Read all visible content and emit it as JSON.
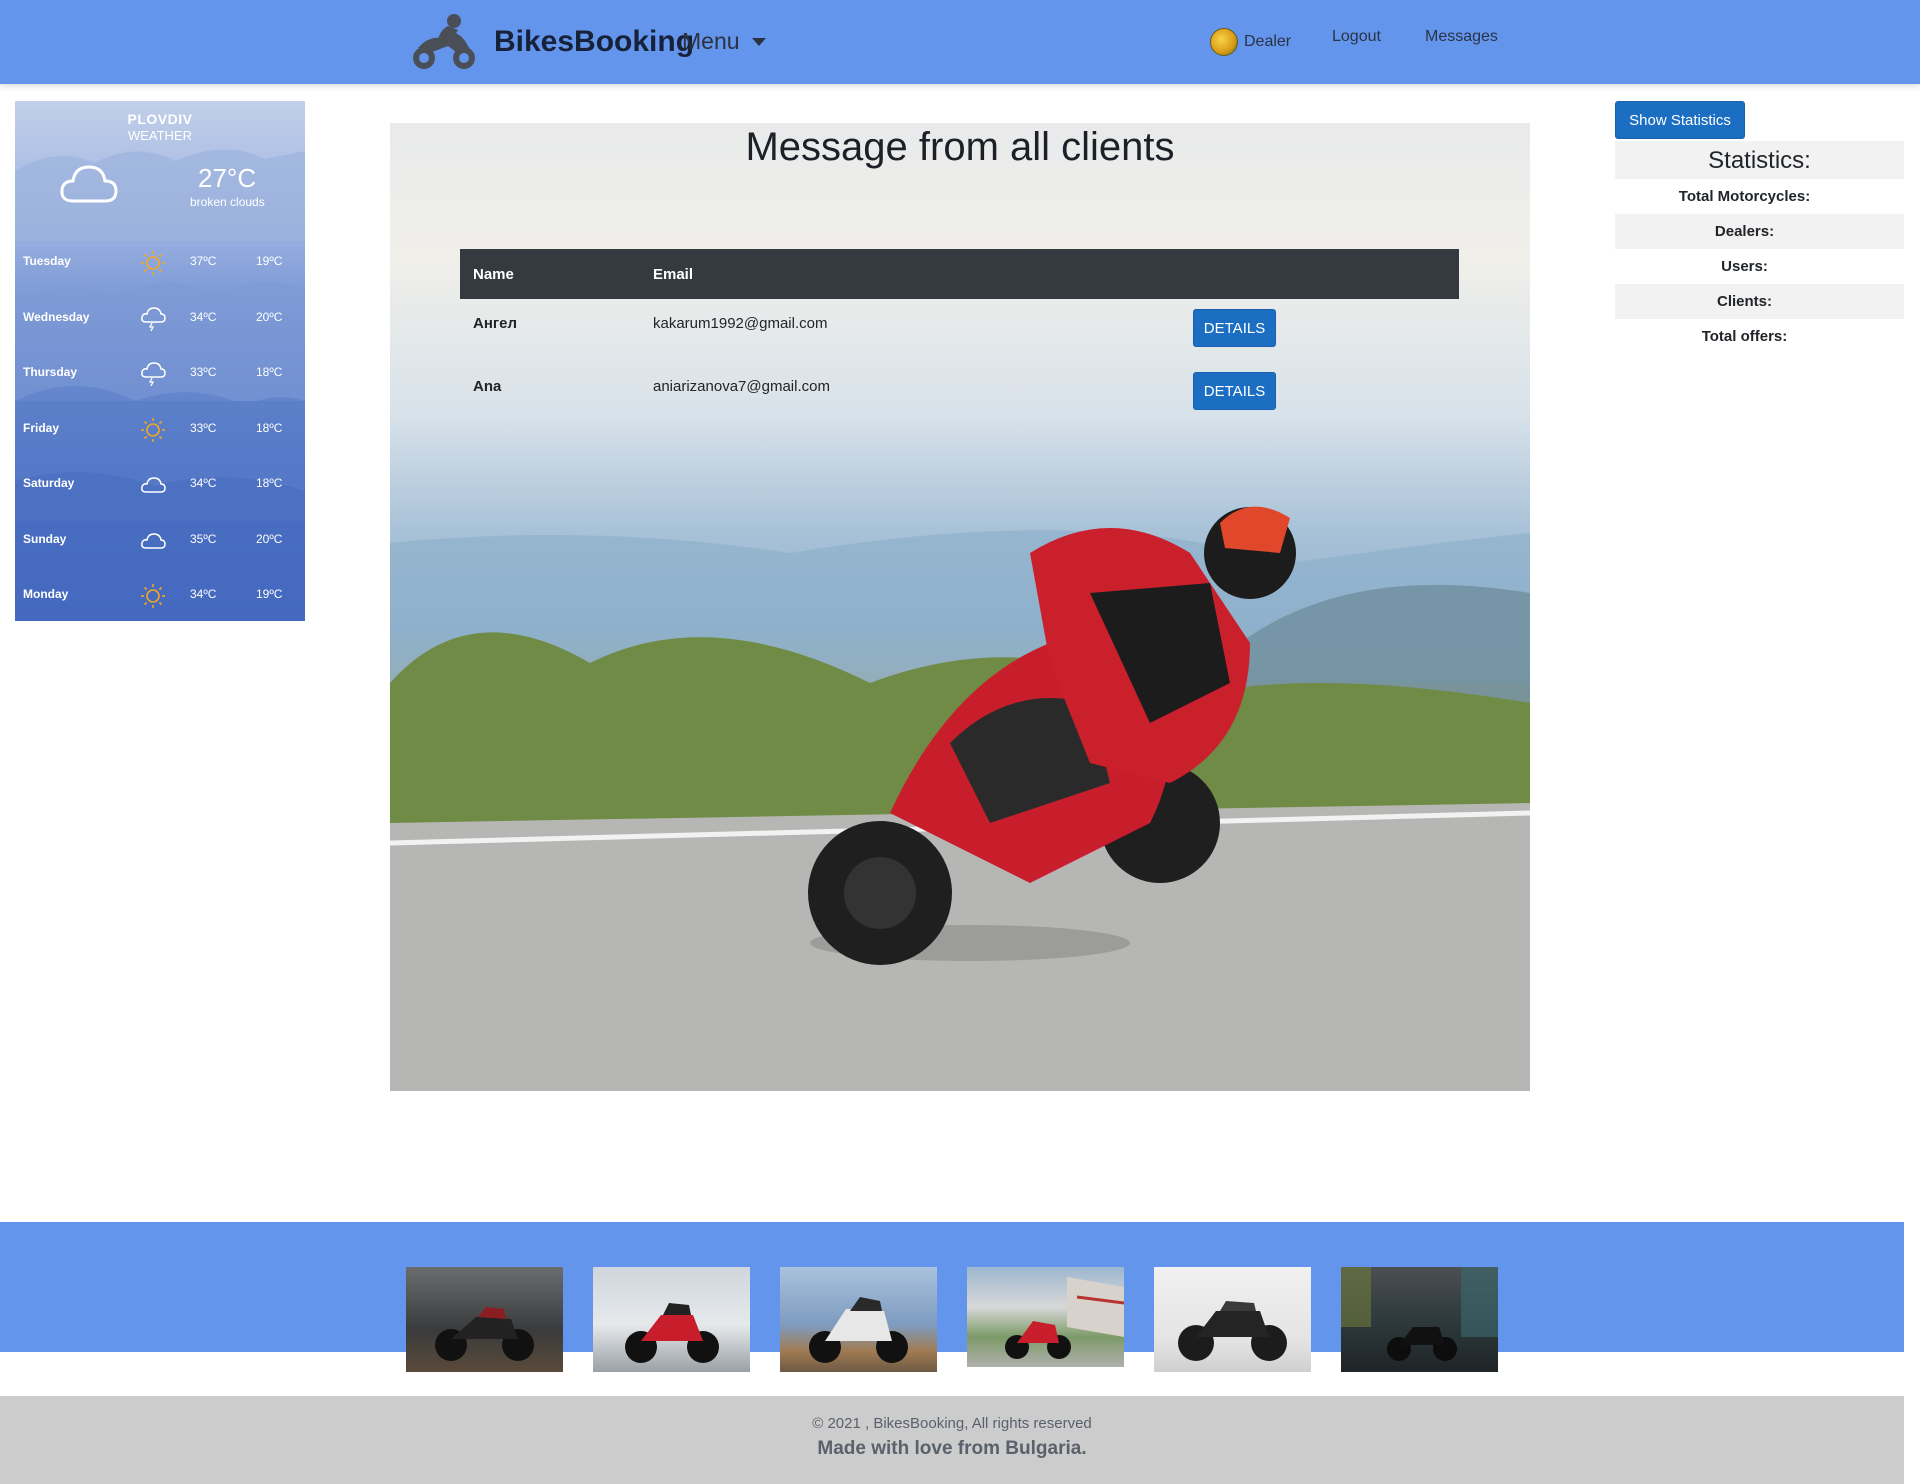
{
  "navbar": {
    "brand": "BikesBooking",
    "menu_label": "Menu",
    "dealer_label": "Dealer",
    "logout_label": "Logout",
    "messages_label": "Messages",
    "color": "#6495ed"
  },
  "weather": {
    "city": "PLOVDIV",
    "label": "WEATHER",
    "current_temp": "27°C",
    "current_desc": "broken clouds",
    "current_icon": "cloud-icon",
    "forecast": [
      {
        "day": "Tuesday",
        "icon": "sun-icon",
        "hi": "37ºC",
        "lo": "19ºC"
      },
      {
        "day": "Wednesday",
        "icon": "thunderstorm-icon",
        "hi": "34ºC",
        "lo": "20ºC"
      },
      {
        "day": "Thursday",
        "icon": "thunderstorm-icon",
        "hi": "33ºC",
        "lo": "18ºC"
      },
      {
        "day": "Friday",
        "icon": "sun-icon",
        "hi": "33ºC",
        "lo": "18ºC"
      },
      {
        "day": "Saturday",
        "icon": "cloud-icon",
        "hi": "34ºC",
        "lo": "18ºC"
      },
      {
        "day": "Sunday",
        "icon": "cloud-icon",
        "hi": "35ºC",
        "lo": "20ºC"
      },
      {
        "day": "Monday",
        "icon": "sun-icon",
        "hi": "34ºC",
        "lo": "19ºC"
      }
    ]
  },
  "main": {
    "title": "Message from all clients",
    "table": {
      "headers": [
        "Name",
        "Email"
      ],
      "rows": [
        {
          "name": "Ангел",
          "email": "kakarum1992@gmail.com",
          "action": "DETAILS"
        },
        {
          "name": "Ana",
          "email": "aniarizanova7@gmail.com",
          "action": "DETAILS"
        }
      ]
    }
  },
  "stats": {
    "button_label": "Show Statistics",
    "title": "Statistics:",
    "items": [
      "Total Motorcycles:",
      "Dealers:",
      "Users:",
      "Clients:",
      "Total offers:"
    ]
  },
  "gallery": {
    "thumbnails": [
      "motorcycle-photo-1",
      "motorcycle-photo-2",
      "motorcycle-photo-3",
      "motorcycle-photo-4",
      "motorcycle-photo-5",
      "motorcycle-photo-6"
    ]
  },
  "footer": {
    "copyright": "© 2021 , BikesBooking, All rights reserved",
    "tagline": "Made with love from Bulgaria."
  },
  "colors": {
    "accent": "#6495ed",
    "button": "#1b6ec2",
    "table_header": "#343a40",
    "footer": "#cccccc"
  }
}
